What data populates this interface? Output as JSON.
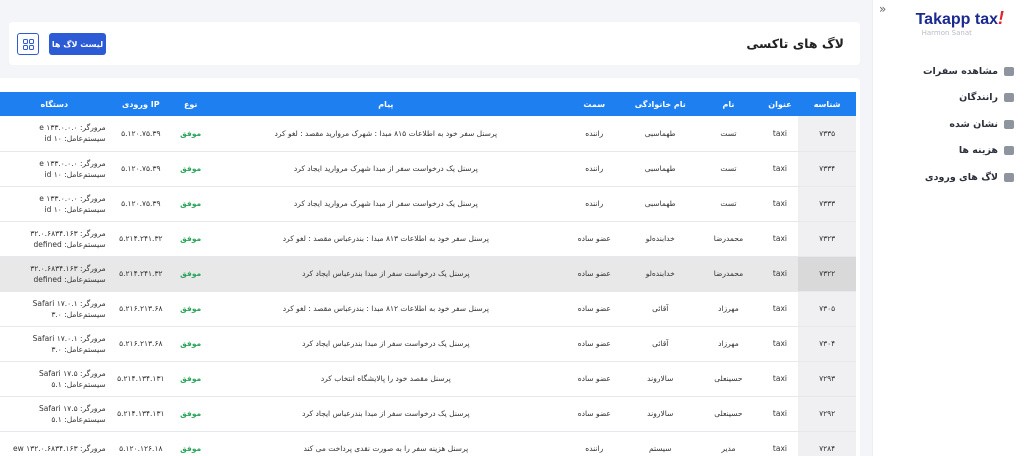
{
  "brand": {
    "name_main": "Takapp tax",
    "name_bang": "!",
    "subtitle": "Harmon Sanat"
  },
  "sidebar": {
    "toggle": "»",
    "items": [
      {
        "label": "مشاهده سفرات",
        "icon": "car-icon"
      },
      {
        "label": "رانندگان",
        "icon": "driver-icon"
      },
      {
        "label": "نشان شده",
        "icon": "bookmark-icon"
      },
      {
        "label": "هزینه ها",
        "icon": "receipt-icon"
      },
      {
        "label": "لاگ های ورودی",
        "icon": "log-icon"
      }
    ]
  },
  "header": {
    "title": "لاگ های تاکسی",
    "logs_button": "لیست لاگ ها",
    "grid_button_icon": "grid-icon"
  },
  "table": {
    "columns": [
      "شناسه",
      "عنوان",
      "نام",
      "نام خانوادگی",
      "سمت",
      "پیام",
      "نوع",
      "IP ورودی",
      "دستگاه"
    ],
    "rows": [
      {
        "id": "۷۳۳۵",
        "title": "taxi",
        "first": "تست",
        "last": "طهماسبی",
        "role": "راننده",
        "msg": "پرسنل سفر خود به اطلاعات ۸۱۵ مبدا : شهرک مروارید مقصد : لغو کرد",
        "status": "موفق",
        "ip": "۵.۱۲۰.۷۵.۳۹",
        "dev1": "مرورگر: e ۱۳۳.۰.۰.۰",
        "dev2": "سیستم‌عامل: id ۱۰",
        "hl": false
      },
      {
        "id": "۷۳۳۴",
        "title": "taxi",
        "first": "تست",
        "last": "طهماسبی",
        "role": "راننده",
        "msg": "پرسنل یک درخواست سفر از مبدا شهرک مروارید ایجاد کرد",
        "status": "موفق",
        "ip": "۵.۱۲۰.۷۵.۳۹",
        "dev1": "مرورگر: e ۱۳۳.۰.۰.۰",
        "dev2": "سیستم‌عامل: id ۱۰",
        "hl": false
      },
      {
        "id": "۷۳۳۳",
        "title": "taxi",
        "first": "تست",
        "last": "طهماسبی",
        "role": "راننده",
        "msg": "پرسنل یک درخواست سفر از مبدا شهرک مروارید ایجاد کرد",
        "status": "موفق",
        "ip": "۵.۱۲۰.۷۵.۳۹",
        "dev1": "مرورگر: e ۱۳۳.۰.۰.۰",
        "dev2": "سیستم‌عامل: id ۱۰",
        "hl": false
      },
      {
        "id": "۷۳۲۳",
        "title": "taxi",
        "first": "محمدرضا",
        "last": "خدابنده‌لو",
        "role": "عضو ساده",
        "msg": "پرسنل سفر خود به اطلاعات ۸۱۳ مبدا : بندرعباس مقصد : لغو کرد",
        "status": "موفق",
        "ip": "۵.۲۱۴.۲۴۱.۳۲",
        "dev1": "مرورگر: ۳۲.۰.۶۸۳۴.۱۶۳",
        "dev2": "سیستم‌عامل: defined",
        "hl": false
      },
      {
        "id": "۷۳۲۲",
        "title": "taxi",
        "first": "محمدرضا",
        "last": "خدابنده‌لو",
        "role": "عضو ساده",
        "msg": "پرسنل یک درخواست سفر از مبدا بندرعباس ایجاد کرد",
        "status": "موفق",
        "ip": "۵.۲۱۴.۲۴۱.۳۲",
        "dev1": "مرورگر: ۳۲.۰.۶۸۳۴.۱۶۳",
        "dev2": "سیستم‌عامل: defined",
        "hl": true
      },
      {
        "id": "۷۳۰۵",
        "title": "taxi",
        "first": "مهرزاد",
        "last": "آقائی",
        "role": "عضو ساده",
        "msg": "پرسنل سفر خود به اطلاعات ۸۱۲ مبدا : بندرعباس مقصد : لغو کرد",
        "status": "موفق",
        "ip": "۵.۲۱۶.۲۱۳.۶۸",
        "dev1": "مرورگر: Safari ۱۷.۰.۱",
        "dev2": "سیستم‌عامل: ۳.۰",
        "hl": false
      },
      {
        "id": "۷۳۰۴",
        "title": "taxi",
        "first": "مهرزاد",
        "last": "آقائی",
        "role": "عضو ساده",
        "msg": "پرسنل یک درخواست سفر از مبدا بندرعباس ایجاد کرد",
        "status": "موفق",
        "ip": "۵.۲۱۶.۲۱۳.۶۸",
        "dev1": "مرورگر: Safari ۱۷.۰.۱",
        "dev2": "سیستم‌عامل: ۳.۰",
        "hl": false
      },
      {
        "id": "۷۲۹۳",
        "title": "taxi",
        "first": "حسینعلی",
        "last": "سالاروند",
        "role": "عضو ساده",
        "msg": "پرسنل مقصد خود را پالایشگاه انتخاب کرد",
        "status": "موفق",
        "ip": "۵.۲۱۴.۱۳۴.۱۳۱",
        "dev1": "مرورگر: Safari ۱۷.۵",
        "dev2": "سیستم‌عامل: ۵.۱",
        "hl": false
      },
      {
        "id": "۷۲۹۲",
        "title": "taxi",
        "first": "حسینعلی",
        "last": "سالاروند",
        "role": "عضو ساده",
        "msg": "پرسنل یک درخواست سفر از مبدا بندرعباس ایجاد کرد",
        "status": "موفق",
        "ip": "۵.۲۱۴.۱۳۴.۱۳۱",
        "dev1": "مرورگر: Safari ۱۷.۵",
        "dev2": "سیستم‌عامل: ۵.۱",
        "hl": false
      },
      {
        "id": "۷۲۸۴",
        "title": "taxi",
        "first": "مدیر",
        "last": "سیستم",
        "role": "راننده",
        "msg": "پرسنل هزینه سفر را به صورت نقدی پرداخت می کند",
        "status": "موفق",
        "ip": "۵.۱۲۰.۱۲۶.۱۸",
        "dev1": "مرورگر: ew ۱۳۲.۰.۶۸۳۴.۱۶۳",
        "dev2": "",
        "hl": false
      }
    ]
  }
}
